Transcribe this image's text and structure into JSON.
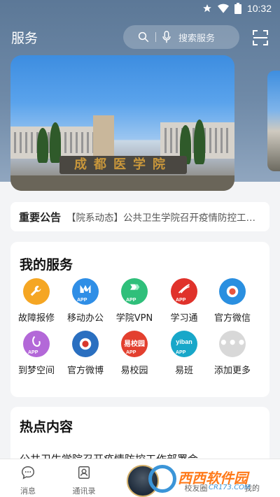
{
  "status_bar": {
    "time": "10:32",
    "icons": [
      "star-icon",
      "wifi-icon",
      "battery-icon"
    ]
  },
  "header": {
    "title": "服务",
    "search_placeholder": "搜索服务",
    "scan_icon": "scan-icon"
  },
  "banner": {
    "sign_text": "成都医学院"
  },
  "notice": {
    "label": "重要公告",
    "text": "【院系动态】公共卫生学院召开疫情防控工作部署会"
  },
  "services": {
    "title": "我的服务",
    "items": [
      {
        "label": "故障报修",
        "icon": "wrench-icon",
        "color": "#f5a623",
        "app_tag": ""
      },
      {
        "label": "移动办公",
        "icon": "mobile-office-icon",
        "color": "#2f8ee6",
        "app_tag": "APP"
      },
      {
        "label": "学院VPN",
        "icon": "vpn-icon",
        "color": "#2fbf7a",
        "app_tag": "APP"
      },
      {
        "label": "学习通",
        "icon": "xuexitong-icon",
        "color": "#e0322b",
        "app_tag": "APP"
      },
      {
        "label": "官方微信",
        "icon": "wechat-icon",
        "color": "#2a8fe0",
        "app_tag": ""
      },
      {
        "label": "到梦空间",
        "icon": "dream-space-icon",
        "color": "#b368d8",
        "app_tag": "APP"
      },
      {
        "label": "官方微博",
        "icon": "weibo-icon",
        "color": "#2a6fc0",
        "app_tag": ""
      },
      {
        "label": "易校园",
        "icon": "yixiaoyuan-icon",
        "color": "#e3402f",
        "app_tag": "APP"
      },
      {
        "label": "易班",
        "icon": "yiban-icon",
        "color": "#18a7c9",
        "app_tag": "APP"
      },
      {
        "label": "添加更多",
        "icon": "more-icon",
        "color": "#d8d8d8",
        "app_tag": ""
      }
    ]
  },
  "hot": {
    "title": "热点内容",
    "first_item": "公共卫生学院召开疫情防控工作部署会"
  },
  "tabbar": {
    "tabs": [
      {
        "label": "消息",
        "icon": "message-icon"
      },
      {
        "label": "通讯录",
        "icon": "contacts-icon"
      },
      {
        "label": "",
        "icon": "home-logo-icon"
      },
      {
        "label": "校友圈",
        "icon": "alumni-icon"
      },
      {
        "label": "我的",
        "icon": "profile-icon"
      }
    ]
  },
  "watermark": {
    "text": "西西软件园",
    "url": "CR173.COM"
  }
}
